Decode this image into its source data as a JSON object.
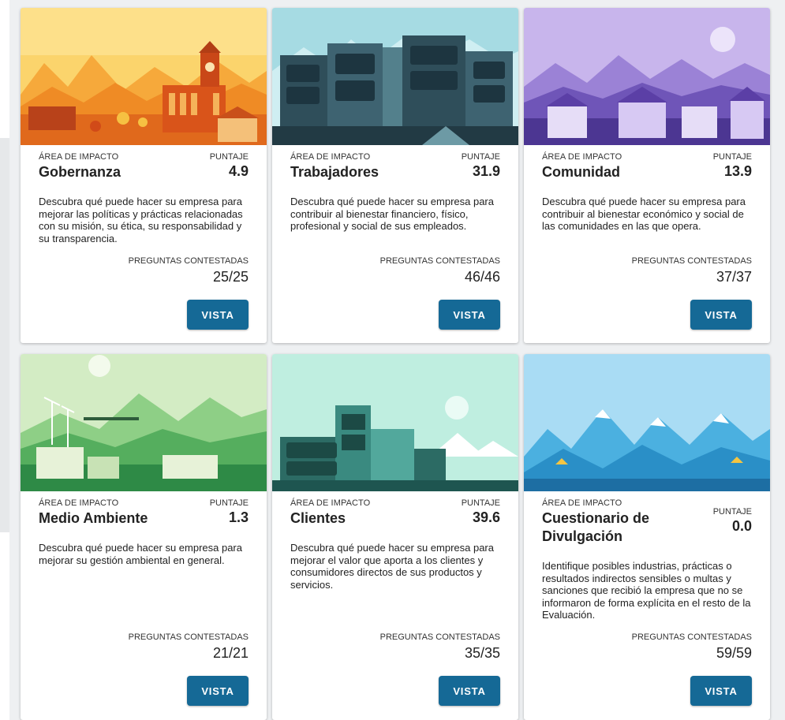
{
  "common": {
    "area_label": "ÁREA DE IMPACTO",
    "score_label": "PUNTAJE",
    "questions_label": "PREGUNTAS CONTESTADAS",
    "view_button": "VISTA"
  },
  "cards": [
    {
      "title": "Gobernanza",
      "score": "4.9",
      "description": "Descubra qué puede hacer su empresa para mejorar las políticas y prácticas relacionadas con su misión, su ética, su responsabilidad y su transparencia.",
      "questions": "25/25",
      "illustration": "town-hall-orange-landscape"
    },
    {
      "title": "Trabajadores",
      "score": "31.9",
      "description": "Descubra qué puede hacer su empresa para contribuir al bienestar financiero, físico, profesional y social de sus empleados.",
      "questions": "46/46",
      "illustration": "office-buildings-teal"
    },
    {
      "title": "Comunidad",
      "score": "13.9",
      "description": "Descubra qué puede hacer su empresa para contribuir al bienestar económico y social de las comunidades en las que opera.",
      "questions": "37/37",
      "illustration": "purple-village"
    },
    {
      "title": "Medio Ambiente",
      "score": "1.3",
      "description": "Descubra qué puede hacer su empresa para mejorar su gestión ambiental en general.",
      "questions": "21/21",
      "illustration": "green-hills-wind-turbines"
    },
    {
      "title": "Clientes",
      "score": "39.6",
      "description": "Descubra qué puede hacer su empresa para mejorar el valor que aporta a los clientes y consumidores directos de sus productos y servicios.",
      "questions": "35/35",
      "illustration": "mint-town-shops"
    },
    {
      "title": "Cuestionario de Divulgación",
      "score": "0.0",
      "description": "Identifique posibles industrias, prácticas o resultados indirectos sensibles o multas y sanciones que recibió la empresa que no se informaron de forma explícita en el resto de la Evaluación.",
      "questions": "59/59",
      "illustration": "blue-mountains-camp"
    }
  ],
  "colors": {
    "button": "#156996",
    "page_background": "#eef0f2"
  }
}
